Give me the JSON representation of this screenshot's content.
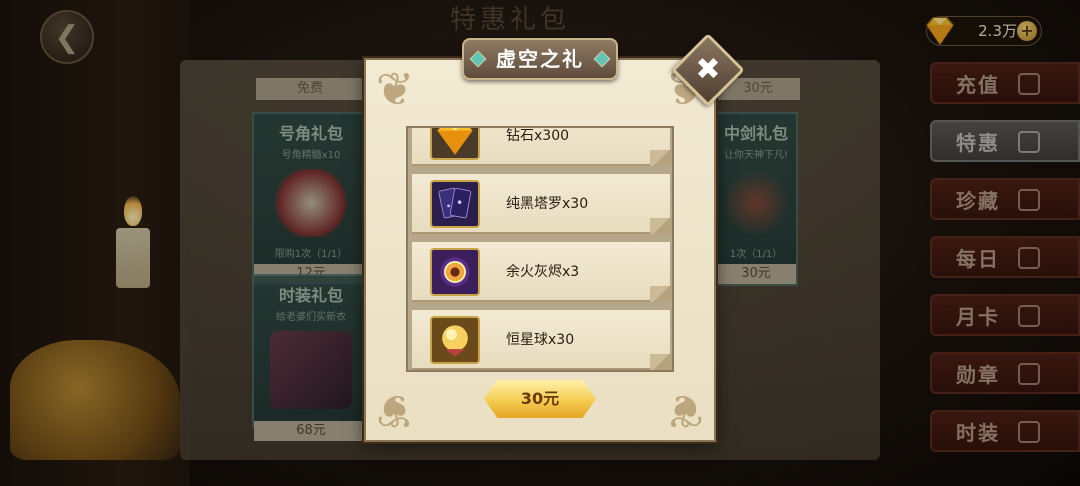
{
  "background": {
    "title": "特惠礼包",
    "free_label": "免费",
    "cards": [
      {
        "title": "号角礼包",
        "subtitle": "号角精髓x10",
        "limit": "限购1次（1/1）",
        "price": "12元"
      },
      {
        "title": "时装礼包",
        "subtitle": "给老婆们买新衣",
        "limit": "",
        "price": "68元"
      },
      {
        "title": "中剑礼包",
        "subtitle": "让你天神下凡!",
        "limit": "1次（1/1）",
        "price": "30元"
      }
    ],
    "top_right_price": "30元"
  },
  "currency": {
    "amount": "2.3万",
    "plus": "+"
  },
  "side_menu": [
    {
      "label": "充值",
      "active": false
    },
    {
      "label": "特惠",
      "active": true
    },
    {
      "label": "珍藏",
      "active": false
    },
    {
      "label": "每日",
      "active": false
    },
    {
      "label": "月卡",
      "active": false
    },
    {
      "label": "勋章",
      "active": false
    },
    {
      "label": "时装",
      "active": false
    }
  ],
  "dialog": {
    "title": "虚空之礼",
    "close_label": "✖",
    "items": [
      {
        "name": "钻石x300",
        "icon": "diamond-icon"
      },
      {
        "name": "纯黑塔罗x30",
        "icon": "tarot-card-icon"
      },
      {
        "name": "余火灰烬x3",
        "icon": "ember-orb-icon"
      },
      {
        "name": "恒星球x30",
        "icon": "star-sphere-icon"
      }
    ],
    "buy_label": "30元"
  },
  "colors": {
    "accent_gold": "#f4cc52",
    "panel_bg": "#f3ead3",
    "menu_red": "#5a2418"
  }
}
